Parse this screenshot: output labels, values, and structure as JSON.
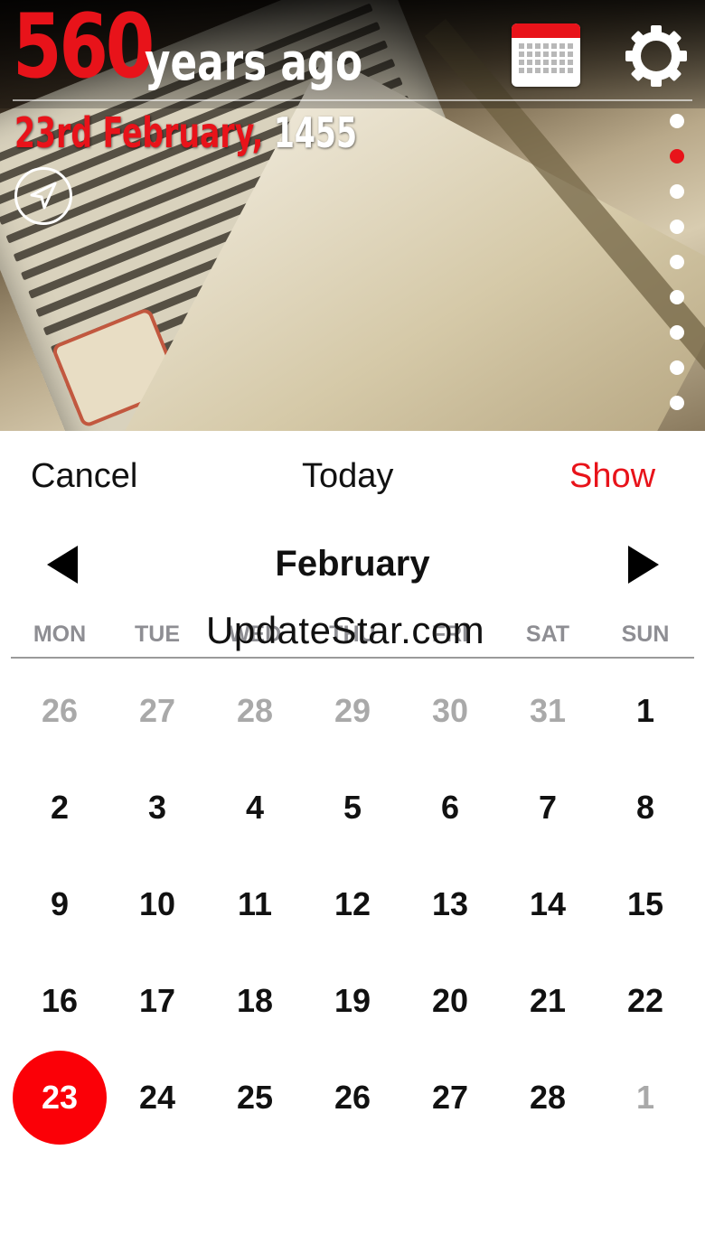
{
  "header": {
    "years_number": "560",
    "years_text": "years ago",
    "date_day_month": "23rd February,",
    "date_year": "1455"
  },
  "page_indicator": {
    "count": 9,
    "active_index": 1
  },
  "actions": {
    "cancel": "Cancel",
    "today": "Today",
    "show": "Show"
  },
  "calendar": {
    "month": "February",
    "weekdays": [
      "MON",
      "TUE",
      "WED",
      "THU",
      "FRI",
      "SAT",
      "SUN"
    ],
    "weeks": [
      [
        {
          "d": "26",
          "m": true
        },
        {
          "d": "27",
          "m": true
        },
        {
          "d": "28",
          "m": true
        },
        {
          "d": "29",
          "m": true
        },
        {
          "d": "30",
          "m": true
        },
        {
          "d": "31",
          "m": true
        },
        {
          "d": "1"
        }
      ],
      [
        {
          "d": "2"
        },
        {
          "d": "3"
        },
        {
          "d": "4"
        },
        {
          "d": "5"
        },
        {
          "d": "6"
        },
        {
          "d": "7"
        },
        {
          "d": "8"
        }
      ],
      [
        {
          "d": "9"
        },
        {
          "d": "10"
        },
        {
          "d": "11"
        },
        {
          "d": "12"
        },
        {
          "d": "13"
        },
        {
          "d": "14"
        },
        {
          "d": "15"
        }
      ],
      [
        {
          "d": "16"
        },
        {
          "d": "17"
        },
        {
          "d": "18"
        },
        {
          "d": "19"
        },
        {
          "d": "20"
        },
        {
          "d": "21"
        },
        {
          "d": "22"
        }
      ],
      [
        {
          "d": "23",
          "sel": true
        },
        {
          "d": "24"
        },
        {
          "d": "25"
        },
        {
          "d": "26"
        },
        {
          "d": "27"
        },
        {
          "d": "28"
        },
        {
          "d": "1",
          "m": true
        }
      ]
    ]
  },
  "watermark": "UpdateStar.com",
  "colors": {
    "accent": "#e8131a",
    "selected": "#fb0007",
    "muted": "#a9a9a9"
  }
}
